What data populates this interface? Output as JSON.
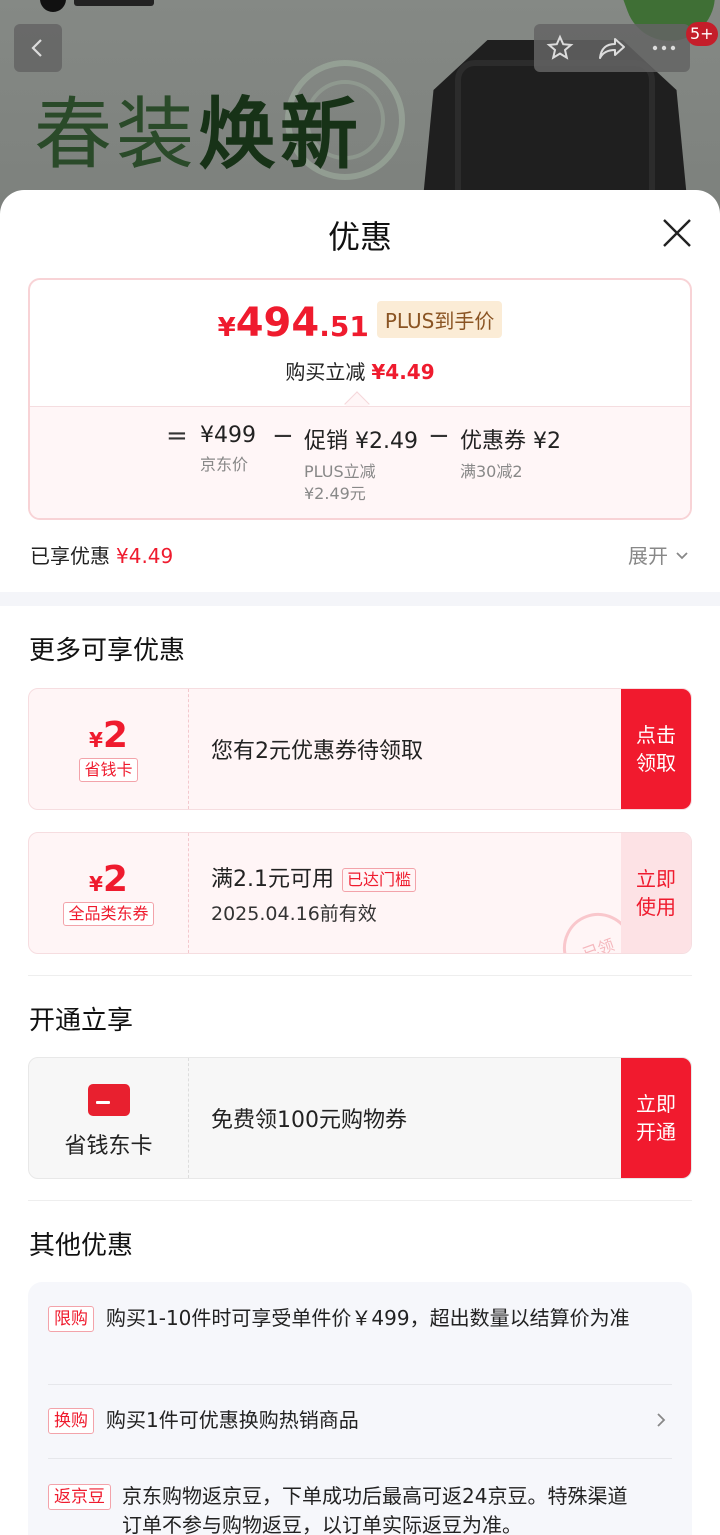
{
  "background": {
    "banner_text_thin": "春装",
    "banner_text_bold": "焕新",
    "badge": "5+"
  },
  "sheet": {
    "title": "优惠"
  },
  "price": {
    "currency": "¥",
    "integer": "494",
    "decimal": ".51",
    "plus_tag": "PLUS到手价",
    "buy_less_label": "购买立减",
    "buy_less_value": "¥4.49",
    "breakdown": {
      "equals": "=",
      "minus": "−",
      "jd_price_value": "¥499",
      "jd_price_label": "京东价",
      "promo_value": "促销 ¥2.49",
      "promo_label1": "PLUS立减",
      "promo_label2": "¥2.49元",
      "coupon_value": "优惠券 ¥2",
      "coupon_label": "满30减2"
    }
  },
  "enjoyed": {
    "label": "已享优惠",
    "value": "¥4.49",
    "expand_label": "展开"
  },
  "more": {
    "title": "更多可享优惠",
    "coupons": [
      {
        "currency": "¥",
        "amount": "2",
        "tag": "省钱卡",
        "main": "您有2元优惠券待领取",
        "cta_line1": "点击",
        "cta_line2": "领取"
      },
      {
        "currency": "¥",
        "amount": "2",
        "tag": "全品类东券",
        "main": "满2.1元可用",
        "threshold": "已达门槛",
        "sub": "2025.04.16前有效",
        "stamp": "已领",
        "cta_line1": "立即",
        "cta_line2": "使用"
      }
    ]
  },
  "open": {
    "title": "开通立享",
    "card_name": "省钱东卡",
    "card_text": "免费领100元购物券",
    "cta_line1": "立即",
    "cta_line2": "开通"
  },
  "other": {
    "title": "其他优惠",
    "items": [
      {
        "label": "限购",
        "text": "购买1-10件时可享受单件价￥499，超出数量以结算价为准"
      },
      {
        "label": "换购",
        "text": "购买1件可优惠换购热销商品"
      },
      {
        "label": "返京豆",
        "text": "京东购物返京豆，下单成功后最高可返24京豆。特殊渠道订单不参与购物返豆，以订单实际返豆为准。"
      }
    ]
  },
  "colors": {
    "accent_red": "#ef1b2e",
    "plus_tag_bg": "#fbecd6",
    "plus_tag_text": "#8a5423"
  }
}
